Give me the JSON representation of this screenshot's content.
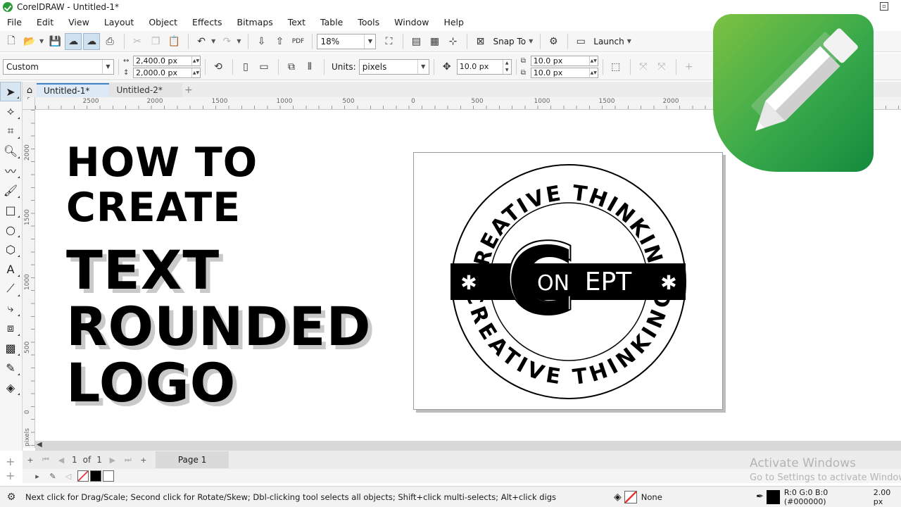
{
  "window": {
    "title": "CorelDRAW - Untitled-1*"
  },
  "menu": [
    "File",
    "Edit",
    "View",
    "Layout",
    "Object",
    "Effects",
    "Bitmaps",
    "Text",
    "Table",
    "Tools",
    "Window",
    "Help"
  ],
  "toolbar": {
    "zoom": "18%",
    "snap_label": "Snap To",
    "launch_label": "Launch"
  },
  "property_bar": {
    "page_preset": "Custom",
    "width": "2,400.0 px",
    "height": "2,000.0 px",
    "units_label": "Units:",
    "units_value": "pixels",
    "nudge": "10.0 px",
    "dup_x": "10.0 px",
    "dup_y": "10.0 px"
  },
  "tabs": [
    {
      "label": "Untitled-1*",
      "active": true
    },
    {
      "label": "Untitled-2*",
      "active": false
    }
  ],
  "ruler": {
    "h_labels": [
      "2500",
      "2000",
      "1500",
      "1000",
      "500",
      "0",
      "500",
      "1000",
      "1500",
      "2000"
    ],
    "v_labels": [
      "2000",
      "1500",
      "1000",
      "500",
      "0"
    ],
    "v_unit": "pixels"
  },
  "canvas": {
    "headline": [
      "HOW TO",
      "CREATE",
      "TEXT",
      "ROUNDED",
      "LOGO"
    ],
    "logo": {
      "top_arc": "CREATIVE THINKING",
      "bottom_arc": "CREATIVE THINKING",
      "initial": "C",
      "band_word_1": "ON",
      "band_word_2": "EPT",
      "band_color": "#000000"
    },
    "app_logo_colors": [
      "#7dc242",
      "#38a94a",
      "#148a3d"
    ]
  },
  "page_nav": {
    "current": "1",
    "of_label": "of",
    "total": "1",
    "page_tab": "Page 1"
  },
  "watermark": {
    "line1": "Activate Windows",
    "line2": "Go to Settings to activate Windows."
  },
  "status": {
    "hint": "Next click for Drag/Scale; Second click for Rotate/Skew; Dbl-clicking tool selects all objects; Shift+click multi-selects; Alt+click digs",
    "fill_label": "None",
    "color_readout": "R:0 G:0 B:0 (#000000)",
    "outline_width": "2.00 px"
  }
}
